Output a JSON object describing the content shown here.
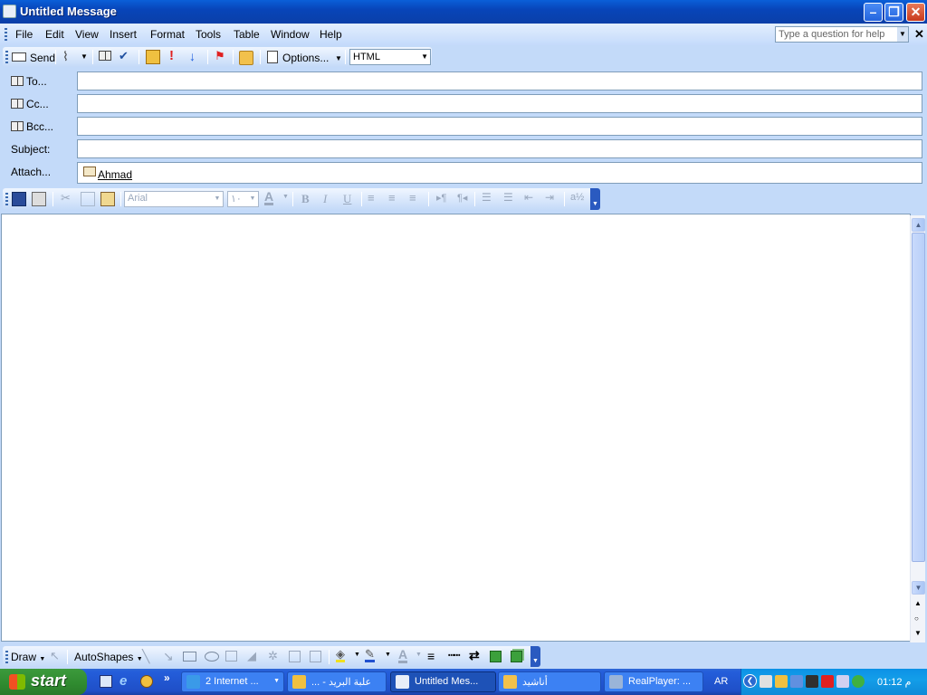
{
  "window": {
    "title": "Untitled Message"
  },
  "menubar": {
    "items": [
      "File",
      "Edit",
      "View",
      "Insert",
      "Format",
      "Tools",
      "Table",
      "Window",
      "Help"
    ],
    "help_placeholder": "Type a question for help"
  },
  "toolbar1": {
    "send_label": "Send",
    "options_label": "Options...",
    "format_value": "HTML"
  },
  "fields": {
    "to_label": "To...",
    "cc_label": "Cc...",
    "bcc_label": "Bcc...",
    "subject_label": "Subject:",
    "attach_label": "Attach...",
    "to_value": "",
    "cc_value": "",
    "bcc_value": "",
    "subject_value": "",
    "attachment_name": "Ahmad"
  },
  "formatting": {
    "font_value": "Arial",
    "size_value": "١٠",
    "bold": "B",
    "italic": "I",
    "underline": "U"
  },
  "drawing": {
    "draw_label": "Draw",
    "autoshapes_label": "AutoShapes"
  },
  "taskbar": {
    "start_label": "start",
    "tasks": [
      {
        "label": "2 Internet ...",
        "active": false
      },
      {
        "label": "علبة البريد - ...",
        "active": false
      },
      {
        "label": "Untitled Mes...",
        "active": true
      },
      {
        "label": "أناشيد",
        "active": false
      },
      {
        "label": "RealPlayer: ...",
        "active": false
      }
    ],
    "language": "AR",
    "clock": "01:12 م"
  },
  "colors": {
    "titlebar": "#0a5fd8",
    "toolbar_bg": "#c3daf9",
    "taskbar": "#245edb",
    "start_green": "#2f8a2f",
    "tray": "#139ee9"
  }
}
